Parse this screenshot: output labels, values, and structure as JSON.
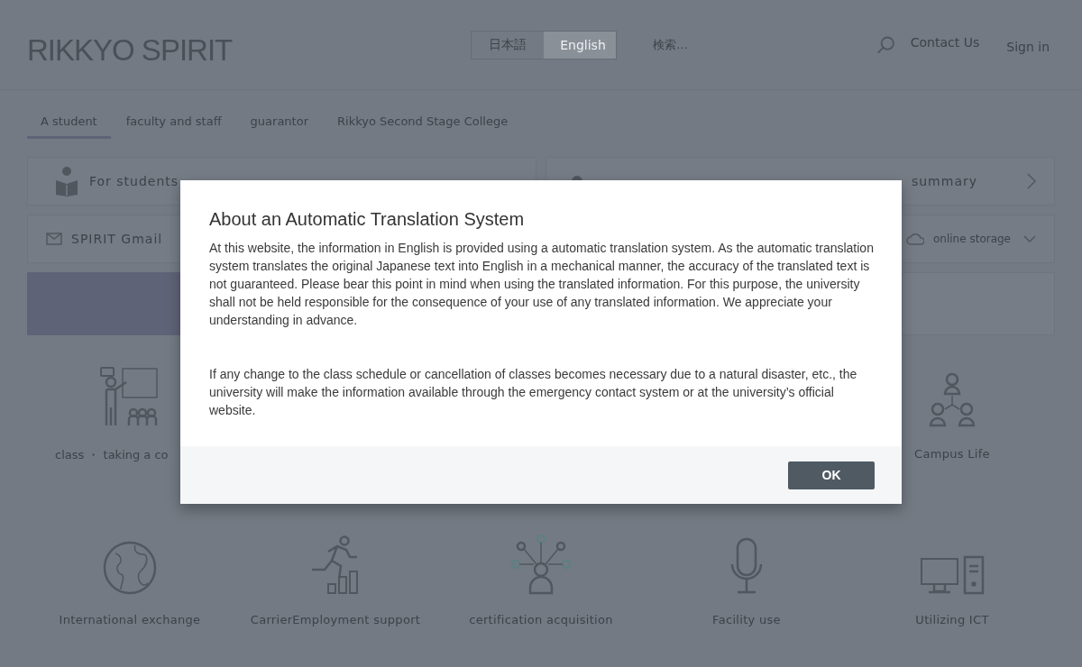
{
  "header": {
    "logo": "RIKKYO SPIRIT",
    "languages": [
      {
        "label": "日本語",
        "selected": false
      },
      {
        "label": "English",
        "selected": true
      }
    ],
    "search": {
      "placeholder": "検索..."
    },
    "links": [
      "Contact Us",
      "Sign in"
    ]
  },
  "tabs": [
    {
      "label": "A student",
      "selected": true
    },
    {
      "label": "faculty and staff",
      "selected": false
    },
    {
      "label": "guarantor",
      "selected": false
    },
    {
      "label": "Rikkyo Second Stage College",
      "selected": false
    }
  ],
  "shortcuts": [
    {
      "kind": "students",
      "label": "For students"
    },
    {
      "kind": "summary",
      "label": "summary"
    },
    {
      "kind": "mail",
      "label": "SPIRIT Gmail"
    },
    {
      "kind": "storage",
      "label": "online storage"
    }
  ],
  "category_rows": [
    [
      {
        "kind": "class",
        "label": "class ・ taking a co"
      },
      {
        "kind": "campus",
        "label": "Campus Life"
      }
    ],
    [
      {
        "kind": "globe",
        "label": "International exchange"
      },
      {
        "kind": "runner",
        "label": "CarrierEmployment support"
      },
      {
        "kind": "network",
        "label": "certification acquisition"
      },
      {
        "kind": "mic",
        "label": "Facility use"
      },
      {
        "kind": "computer",
        "label": "Utilizing ICT"
      }
    ]
  ],
  "dialog": {
    "title": "About an Automatic Translation System",
    "paragraphs": [
      "At this website, the information in English is provided using a automatic translation system. As the automatic translation system translates the original Japanese text into English in a mechanical manner, the accuracy of the translated text is not guaranteed. Please bear this point in mind when using the translated information. For this purpose, the university shall not be held responsible for the consequence of your use of any translated information. We appreciate your understanding in advance.",
      "If any change to the class schedule or cancellation of classes becomes necessary due to a natural disaster, etc., the university will make the information available through the emergency contact system or at the university’s official website."
    ],
    "button": "OK"
  }
}
